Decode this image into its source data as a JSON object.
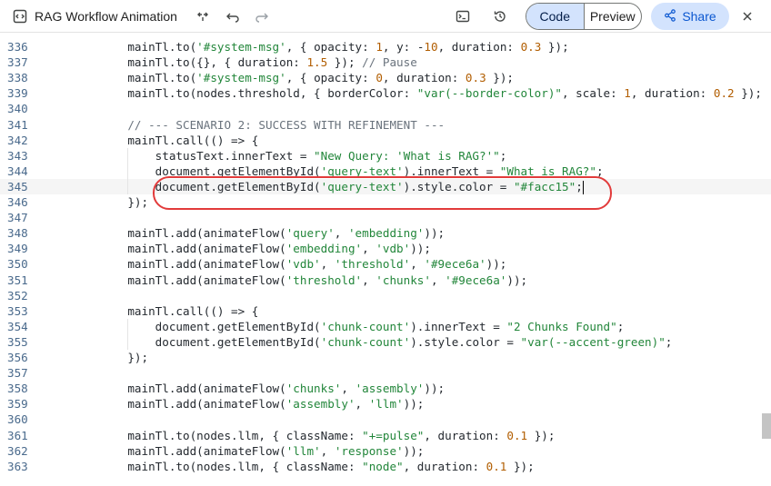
{
  "header": {
    "title": "RAG Workflow Animation",
    "code_tab": "Code",
    "preview_tab": "Preview",
    "share_label": "Share"
  },
  "editor": {
    "current_line": "345",
    "lines": [
      {
        "num": "336",
        "text": "    mainTl.to('#system-msg', { opacity: 1, y: -10, duration: 0.3 });"
      },
      {
        "num": "337",
        "text": "    mainTl.to({}, { duration: 1.5 }); // Pause"
      },
      {
        "num": "338",
        "text": "    mainTl.to('#system-msg', { opacity: 0, duration: 0.3 });"
      },
      {
        "num": "339",
        "text": "    mainTl.to(nodes.threshold, { borderColor: \"var(--border-color)\", scale: 1, duration: 0.2 });"
      },
      {
        "num": "340",
        "text": ""
      },
      {
        "num": "341",
        "text": "    // --- SCENARIO 2: SUCCESS WITH REFINEMENT ---"
      },
      {
        "num": "342",
        "text": "    mainTl.call(() => {"
      },
      {
        "num": "343",
        "text": "        statusText.innerText = \"New Query: 'What is RAG?'\";"
      },
      {
        "num": "344",
        "text": "        document.getElementById('query-text').innerText = \"What is RAG?\";"
      },
      {
        "num": "345",
        "text": "        document.getElementById('query-text').style.color = \"#facc15\";"
      },
      {
        "num": "346",
        "text": "    });"
      },
      {
        "num": "347",
        "text": ""
      },
      {
        "num": "348",
        "text": "    mainTl.add(animateFlow('query', 'embedding'));"
      },
      {
        "num": "349",
        "text": "    mainTl.add(animateFlow('embedding', 'vdb'));"
      },
      {
        "num": "350",
        "text": "    mainTl.add(animateFlow('vdb', 'threshold', '#9ece6a'));"
      },
      {
        "num": "351",
        "text": "    mainTl.add(animateFlow('threshold', 'chunks', '#9ece6a'));"
      },
      {
        "num": "352",
        "text": ""
      },
      {
        "num": "353",
        "text": "    mainTl.call(() => {"
      },
      {
        "num": "354",
        "text": "        document.getElementById('chunk-count').innerText = \"2 Chunks Found\";"
      },
      {
        "num": "355",
        "text": "        document.getElementById('chunk-count').style.color = \"var(--accent-green)\";"
      },
      {
        "num": "356",
        "text": "    });"
      },
      {
        "num": "357",
        "text": ""
      },
      {
        "num": "358",
        "text": "    mainTl.add(animateFlow('chunks', 'assembly'));"
      },
      {
        "num": "359",
        "text": "    mainTl.add(animateFlow('assembly', 'llm'));"
      },
      {
        "num": "360",
        "text": ""
      },
      {
        "num": "361",
        "text": "    mainTl.to(nodes.llm, { className: \"+=pulse\", duration: 0.1 });"
      },
      {
        "num": "362",
        "text": "    mainTl.add(animateFlow('llm', 'response'));"
      },
      {
        "num": "363",
        "text": "    mainTl.to(nodes.llm, { className: \"node\", duration: 0.1 });"
      }
    ]
  },
  "icons": [
    "code-embed-icon",
    "restore-icon",
    "undo-icon",
    "redo-icon",
    "terminal-icon",
    "history-icon",
    "share-icon",
    "close-icon"
  ]
}
